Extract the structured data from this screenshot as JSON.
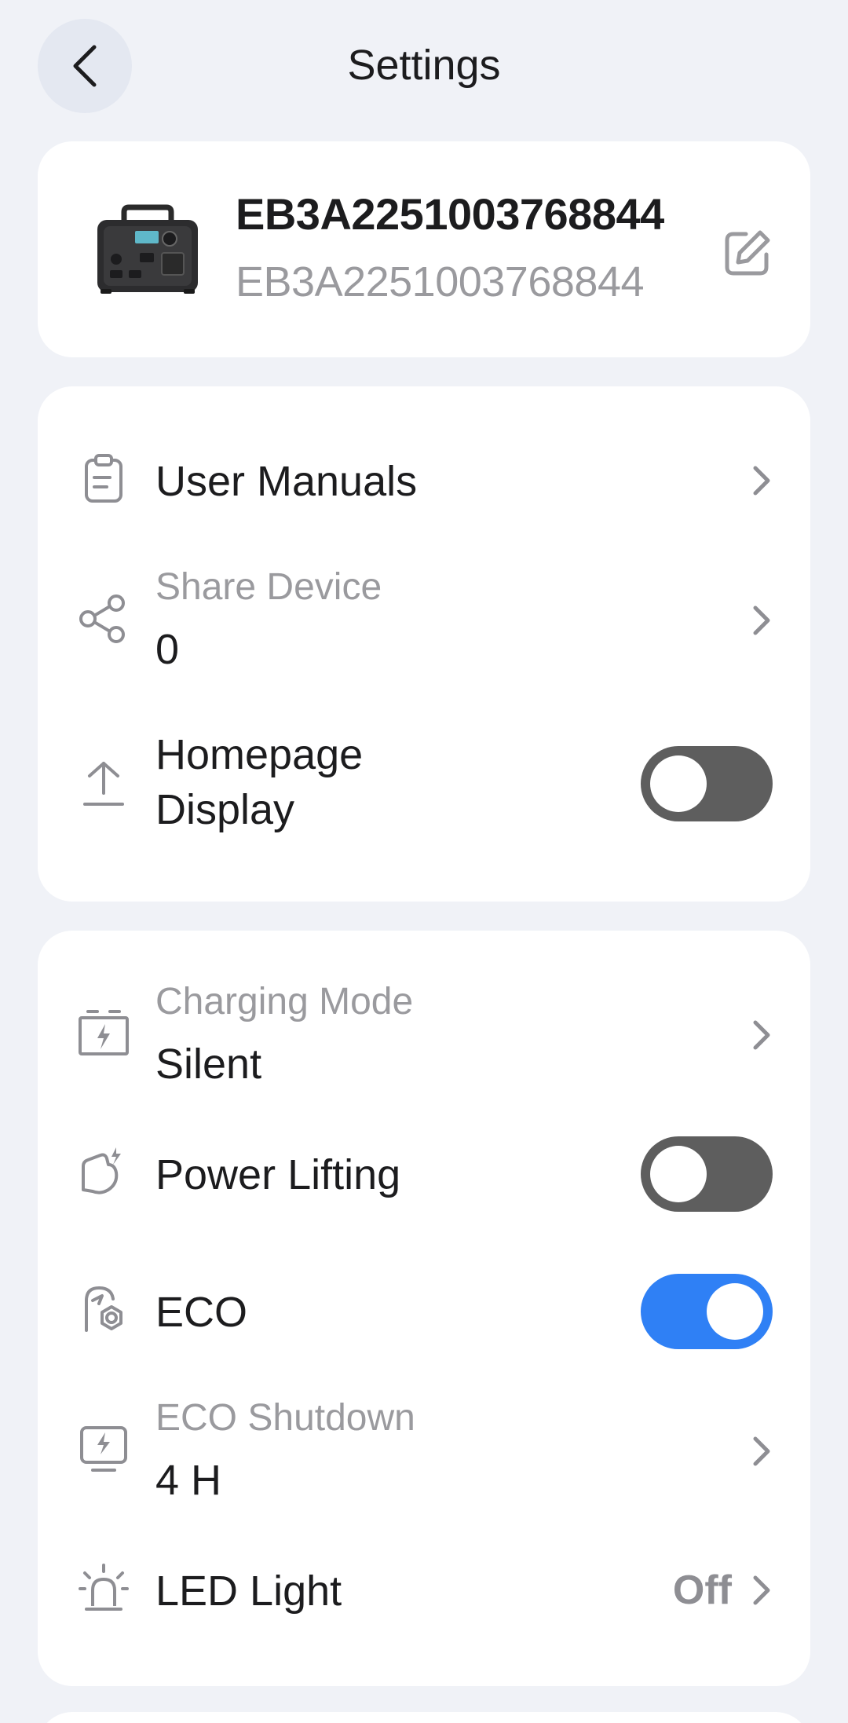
{
  "header": {
    "title": "Settings"
  },
  "device": {
    "name": "EB3A2251003768844",
    "serial": "EB3A2251003768844"
  },
  "group1": {
    "user_manuals": {
      "label": "User Manuals"
    },
    "share_device": {
      "label": "Share Device",
      "value": "0"
    },
    "homepage_display": {
      "label_line1": "Homepage",
      "label_line2": "Display",
      "enabled": false
    }
  },
  "group2": {
    "charging_mode": {
      "label": "Charging Mode",
      "value": "Silent"
    },
    "power_lifting": {
      "label": "Power Lifting",
      "enabled": false
    },
    "eco": {
      "label": "ECO",
      "enabled": true
    },
    "eco_shutdown": {
      "label": "ECO Shutdown",
      "value": "4 H"
    },
    "led_light": {
      "label": "LED Light",
      "value": "Off"
    }
  },
  "colors": {
    "background": "#f0f2f7",
    "card": "#ffffff",
    "toggle_on": "#2f80f5",
    "toggle_off": "#5e5e5e",
    "secondary_text": "#9a9a9e"
  },
  "icons": {
    "back": "chevron-left-icon",
    "edit": "edit-icon",
    "user_manuals": "clipboard-icon",
    "share_device": "share-icon",
    "homepage_display": "upload-icon",
    "charging_mode": "battery-charge-icon",
    "power_lifting": "power-lift-icon",
    "eco": "eco-icon",
    "eco_shutdown": "monitor-bolt-icon",
    "led_light": "alarm-light-icon",
    "chevron": "chevron-right-icon"
  }
}
